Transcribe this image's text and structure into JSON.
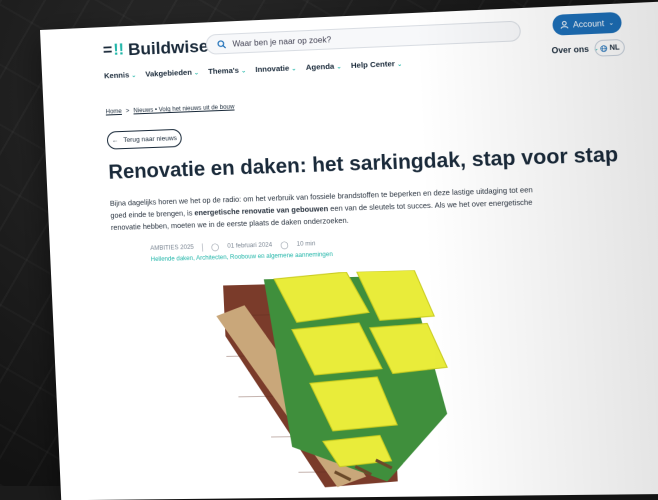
{
  "header": {
    "logo_text": "Buildwise",
    "search_placeholder": "Waar ben je naar op zoek?",
    "account_label": "Account",
    "over_ons_label": "Over ons",
    "lang_label": "NL"
  },
  "nav": {
    "items": [
      {
        "label": "Kennis"
      },
      {
        "label": "Vakgebieden"
      },
      {
        "label": "Thema's"
      },
      {
        "label": "Innovatie"
      },
      {
        "label": "Agenda"
      },
      {
        "label": "Help Center"
      }
    ]
  },
  "breadcrumb": {
    "home": "Home",
    "separator": ">",
    "current": "Nieuws • Volg het nieuws uit de bouw"
  },
  "back_button_label": "Terug naar nieuws",
  "article": {
    "title": "Renovatie en daken: het sarkingdak, stap voor stap",
    "intro_part1": "Bijna dagelijks horen we het op de radio: om het verbruik van fossiele brandstoffen te beperken en deze lastige uitdaging tot een goed einde te brengen, is ",
    "intro_bold": "energetische renovatie van gebouwen",
    "intro_part2": " een van de sleutels tot succes. Als we het over energetische renovatie hebben, moeten we in de eerste plaats de daken onderzoeken.",
    "source": "AMBITIES 2025",
    "date": "01 februari 2024",
    "read_time": "10 min",
    "tags": "Hellende daken,  Architecten,  Roobouw en algemene aannemingen"
  },
  "colors": {
    "primary": "#1a2a3a",
    "accent": "#1fb5a8",
    "account_blue": "#1d6fb8",
    "insulation_yellow": "#e9ec3a",
    "membrane_green": "#3f8f3c",
    "brick": "#7a3b2a"
  }
}
